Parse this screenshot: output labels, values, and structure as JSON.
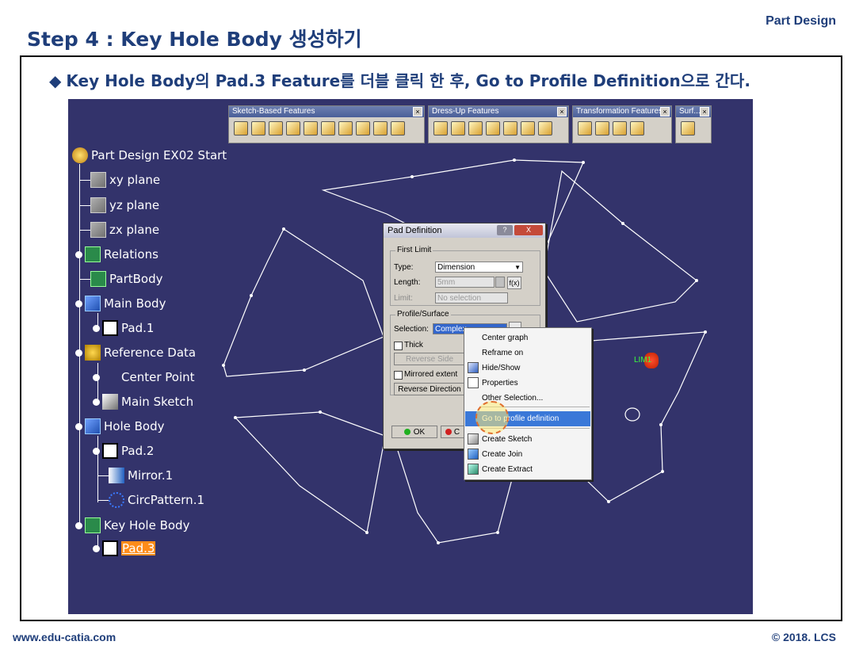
{
  "slide": {
    "title": "Step 4 : Key Hole Body 생성하기",
    "brand": "Part Design",
    "instruction": "Key Hole Body의 Pad.3 Feature를 더블 클릭 한 후, Go to Profile Definition으로 간다.",
    "bullet": "◆",
    "footer_url": "www.edu-catia.com",
    "footer_copy": "© 2018. LCS"
  },
  "toolbars": [
    {
      "title": "Sketch-Based Features"
    },
    {
      "title": "Dress-Up Features"
    },
    {
      "title": "Transformation Features"
    },
    {
      "title": "Surf..."
    }
  ],
  "tree": {
    "root": "Part Design EX02 Start",
    "items": [
      "xy plane",
      "yz plane",
      "zx plane",
      "Relations",
      "PartBody",
      "Main Body",
      "Pad.1",
      "Reference Data",
      "Center Point",
      "Main Sketch",
      "Hole Body",
      "Pad.2",
      "Mirror.1",
      "CircPattern.1",
      "Key Hole Body",
      "Pad.3"
    ]
  },
  "dialog": {
    "title": "Pad Definition",
    "help": "?",
    "close": "X",
    "first_limit": "First Limit",
    "type_label": "Type:",
    "type_value": "Dimension",
    "length_label": "Length:",
    "length_value": "5mm",
    "limit_label": "Limit:",
    "limit_value": "No selection",
    "profile_surface": "Profile/Surface",
    "selection_label": "Selection:",
    "selection_value": "Complex",
    "thick": "Thick",
    "reverse_side": "Reverse Side",
    "mirrored_extent": "Mirrored extent",
    "reverse_direction": "Reverse Direction",
    "ok": "OK",
    "cancel": "C"
  },
  "context_menu": {
    "items": [
      "Center graph",
      "Reframe on",
      "Hide/Show",
      "Properties",
      "Other Selection...",
      "Go to profile definition",
      "Create Sketch",
      "Create Join",
      "Create Extract"
    ]
  },
  "viewport": {
    "lim_label": "LIM1",
    "background": "#33336b"
  }
}
